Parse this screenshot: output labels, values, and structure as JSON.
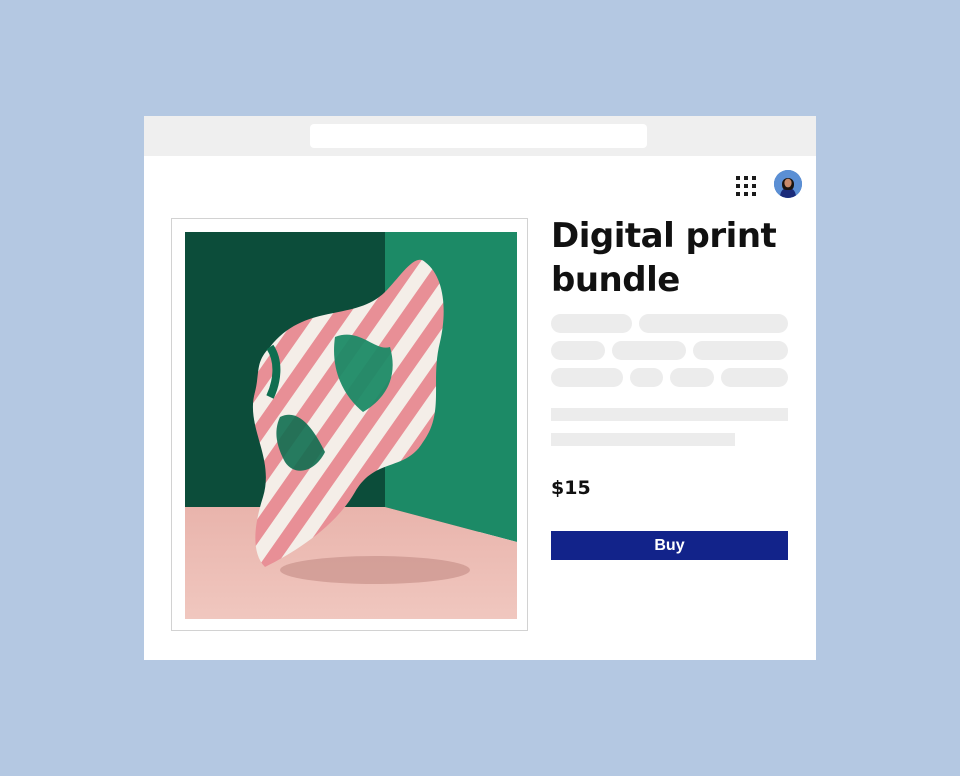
{
  "product": {
    "title": "Digital print bundle",
    "price": "$15",
    "buy_label": "Buy"
  },
  "header": {
    "apps_icon": "grid-icon",
    "avatar_icon": "user-avatar"
  },
  "colors": {
    "background": "#b4c8e2",
    "buy_button": "#12238a",
    "placeholder": "#ececec"
  }
}
